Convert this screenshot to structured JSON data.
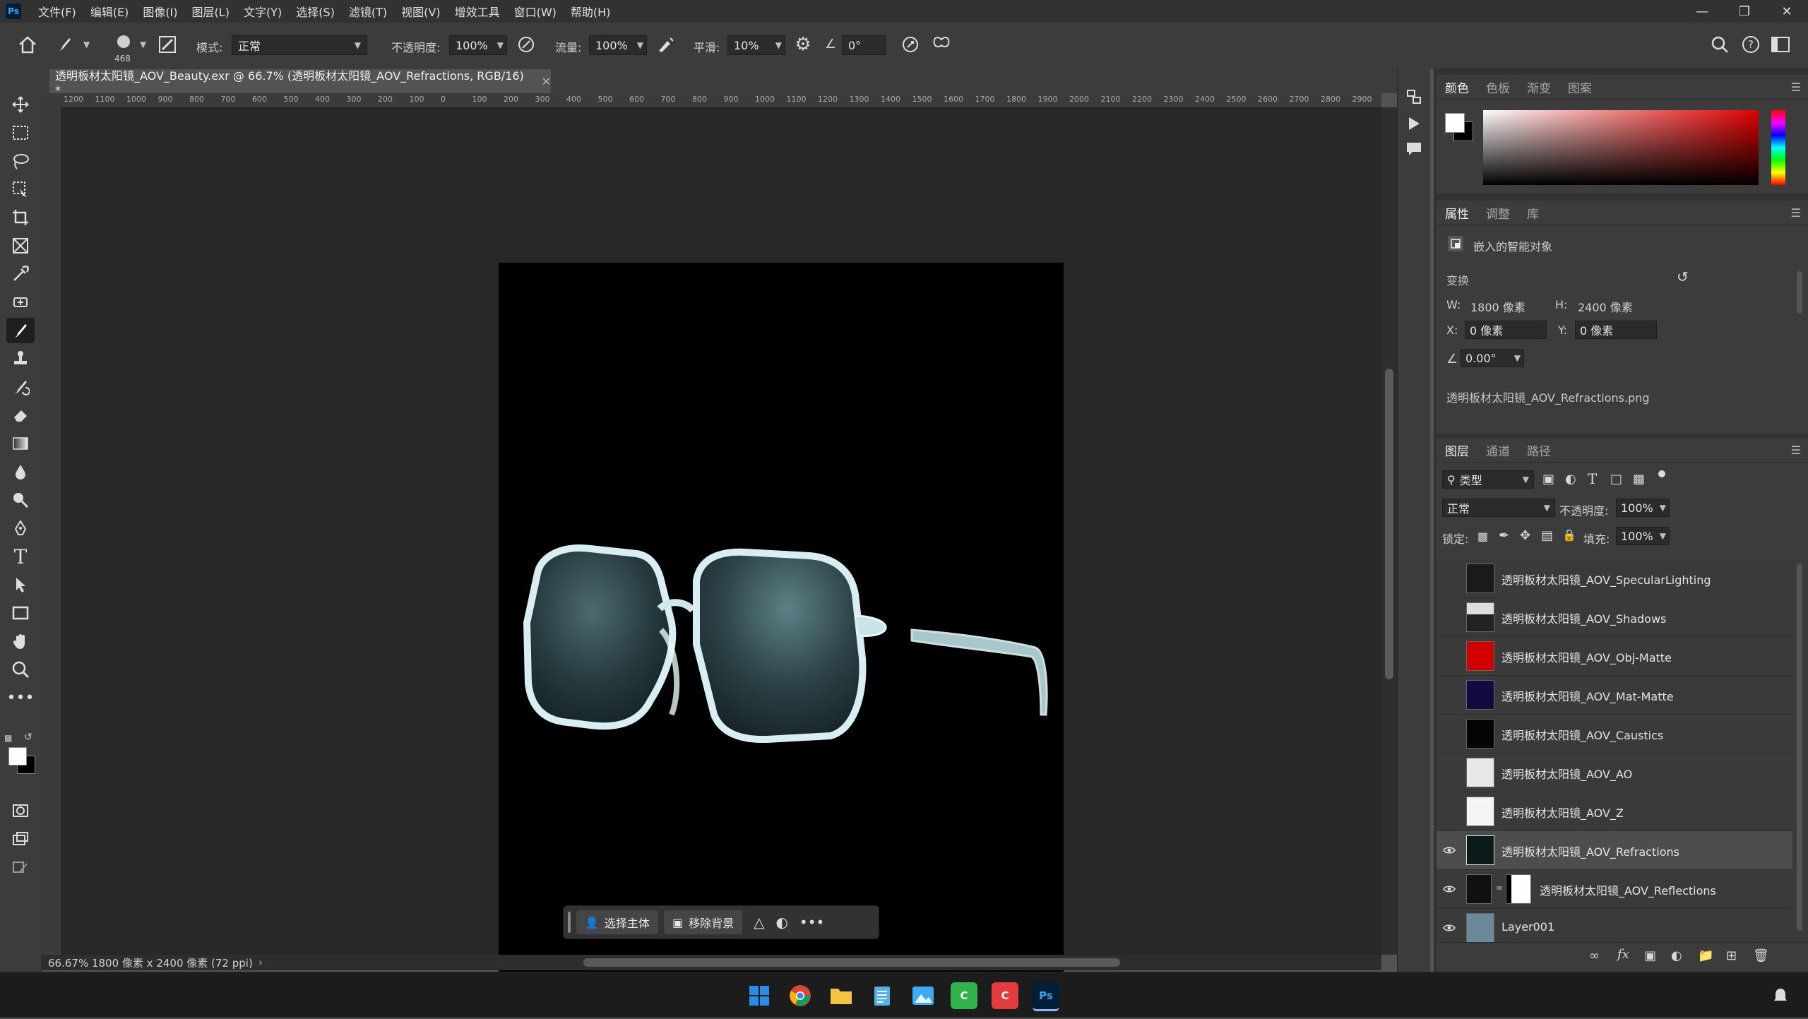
{
  "menubar": {
    "app_logo": "Ps",
    "items": [
      "文件(F)",
      "编辑(E)",
      "图像(I)",
      "图层(L)",
      "文字(Y)",
      "选择(S)",
      "滤镜(T)",
      "视图(V)",
      "增效工具",
      "窗口(W)",
      "帮助(H)"
    ]
  },
  "options": {
    "brush_size": "468",
    "mode_label": "模式:",
    "mode_value": "正常",
    "opacity_label": "不透明度:",
    "opacity_value": "100%",
    "flow_label": "流量:",
    "flow_value": "100%",
    "smooth_label": "平滑:",
    "smooth_value": "10%",
    "angle_value": "0°"
  },
  "document": {
    "tab_title": "透明板材太阳镜_AOV_Beauty.exr @ 66.7% (透明板材太阳镜_AOV_Refractions, RGB/16) *",
    "ruler_ticks": [
      "1200",
      "1100",
      "1000",
      "900",
      "800",
      "700",
      "600",
      "500",
      "400",
      "300",
      "200",
      "100",
      "0",
      "100",
      "200",
      "300",
      "400",
      "500",
      "600",
      "700",
      "800",
      "900",
      "1000",
      "1100",
      "1200",
      "1300",
      "1400",
      "1500",
      "1600",
      "1700",
      "1800",
      "1900",
      "2000",
      "2100",
      "2200",
      "2300",
      "2400",
      "2500",
      "2600",
      "2700",
      "2800",
      "2900"
    ],
    "status": "66.67%  1800 像素 x 2400 像素 (72 ppi)"
  },
  "context_bar": {
    "select_subject": "选择主体",
    "remove_background": "移除背景"
  },
  "color_panel": {
    "tabs": [
      "颜色",
      "色板",
      "渐变",
      "图案"
    ]
  },
  "properties_panel": {
    "tabs": [
      "属性",
      "调整",
      "库"
    ],
    "object_type": "嵌入的智能对象",
    "transform_label": "变换",
    "w_label": "W:",
    "w_value": "1800 像素",
    "h_label": "H:",
    "h_value": "2400 像素",
    "x_label": "X:",
    "x_value": "0 像素",
    "y_label": "Y:",
    "y_value": "0 像素",
    "angle_value": "0.00°",
    "filename": "透明板材太阳镜_AOV_Refractions.png"
  },
  "layers_panel": {
    "tabs": [
      "图层",
      "通道",
      "路径"
    ],
    "filter_label": "类型",
    "blend_mode": "正常",
    "opacity_label": "不透明度:",
    "opacity_value": "100%",
    "lock_label": "锁定:",
    "fill_label": "填充:",
    "fill_value": "100%",
    "layers": [
      {
        "name": "透明板材太阳镜_AOV_SpecularLighting",
        "visible": false,
        "thumb": "#222222"
      },
      {
        "name": "透明板材太阳镜_AOV_Shadows",
        "visible": false,
        "thumb": "#333333"
      },
      {
        "name": "透明板材太阳镜_AOV_Obj-Matte",
        "visible": false,
        "thumb": "#d00000"
      },
      {
        "name": "透明板材太阳镜_AOV_Mat-Matte",
        "visible": false,
        "thumb": "#1a1060"
      },
      {
        "name": "透明板材太阳镜_AOV_Caustics",
        "visible": false,
        "thumb": "#050505"
      },
      {
        "name": "透明板材太阳镜_AOV_AO",
        "visible": false,
        "thumb": "#e8e8e8"
      },
      {
        "name": "透明板材太阳镜_AOV_Z",
        "visible": false,
        "thumb": "#f2f2f2"
      },
      {
        "name": "透明板材太阳镜_AOV_Refractions",
        "visible": true,
        "thumb": "#0b1a1a",
        "selected": true
      },
      {
        "name": "透明板材太阳镜_AOV_Reflections",
        "visible": true,
        "thumb": "#101010",
        "mask": true
      },
      {
        "name": "Layer001",
        "visible": true,
        "thumb": "#6a8a9a"
      }
    ]
  },
  "colors": {
    "accent": "#31a8ff",
    "ps_bg": "#001e36"
  }
}
